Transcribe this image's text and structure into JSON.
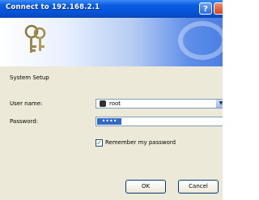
{
  "window": {
    "title": "Connect to 192.168.2.1",
    "help_label": "?"
  },
  "form": {
    "section_label": "System Setup",
    "username_label": "User name:",
    "username_value": "root",
    "password_label": "Password:",
    "password_mask": "••••",
    "remember_label": "Remember my password",
    "remember_checked": true
  },
  "buttons": {
    "ok": "OK",
    "cancel": "Cancel"
  }
}
